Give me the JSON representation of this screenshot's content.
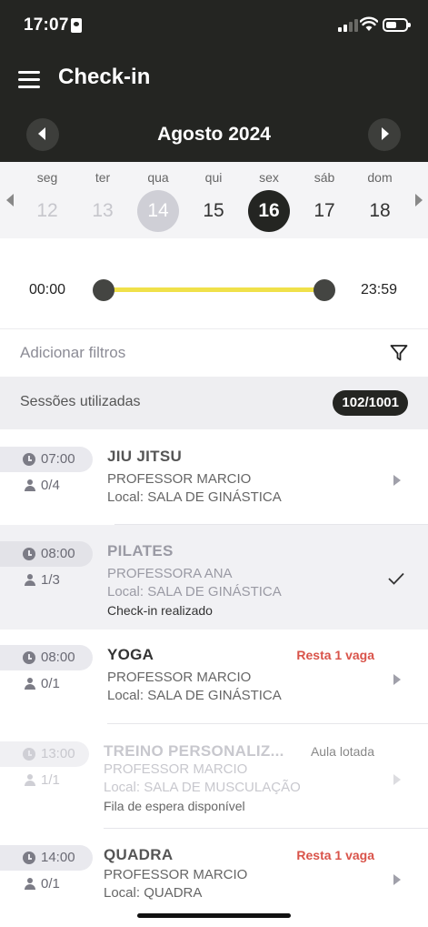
{
  "status_bar": {
    "time": "17:07"
  },
  "header": {
    "title": "Check-in",
    "month": "Agosto 2024"
  },
  "days": [
    {
      "name": "seg",
      "num": "12",
      "state": "past"
    },
    {
      "name": "ter",
      "num": "13",
      "state": "past"
    },
    {
      "name": "qua",
      "num": "14",
      "state": "today"
    },
    {
      "name": "qui",
      "num": "15",
      "state": "normal"
    },
    {
      "name": "sex",
      "num": "16",
      "state": "selected"
    },
    {
      "name": "sáb",
      "num": "17",
      "state": "normal"
    },
    {
      "name": "dom",
      "num": "18",
      "state": "normal"
    }
  ],
  "time_range": {
    "start": "00:00",
    "end": "23:59"
  },
  "filters": {
    "placeholder": "Adicionar filtros"
  },
  "sessions": {
    "label": "Sessões utilizadas",
    "value": "102/1001"
  },
  "classes": [
    {
      "time": "07:00",
      "capacity": "0/4",
      "name": "JIU JITSU",
      "professor": "PROFESSOR MARCIO",
      "local": "Local: SALA DE GINÁSTICA"
    },
    {
      "time": "08:00",
      "capacity": "1/3",
      "name": "PILATES",
      "professor": "PROFESSORA ANA",
      "local": "Local: SALA DE GINÁSTICA",
      "note": "Check-in realizado"
    },
    {
      "time": "08:00",
      "capacity": "0/1",
      "name": "YOGA",
      "professor": "PROFESSOR MARCIO",
      "local": "Local: SALA DE GINÁSTICA",
      "tag": "Resta 1 vaga"
    },
    {
      "time": "13:00",
      "capacity": "1/1",
      "name": "TREINO PERSONALIZ...",
      "professor": "PROFESSOR MARCIO",
      "local": "Local: SALA DE MUSCULAÇÃO",
      "note": "Fila de espera disponível",
      "tag": "Aula lotada"
    },
    {
      "time": "14:00",
      "capacity": "0/1",
      "name": "QUADRA",
      "professor": "PROFESSOR MARCIO",
      "local": "Local: QUADRA",
      "tag": "Resta 1 vaga"
    }
  ],
  "colors": {
    "header_bg": "#242522",
    "slider_track": "#f0e14a",
    "alert": "#d9534a"
  }
}
